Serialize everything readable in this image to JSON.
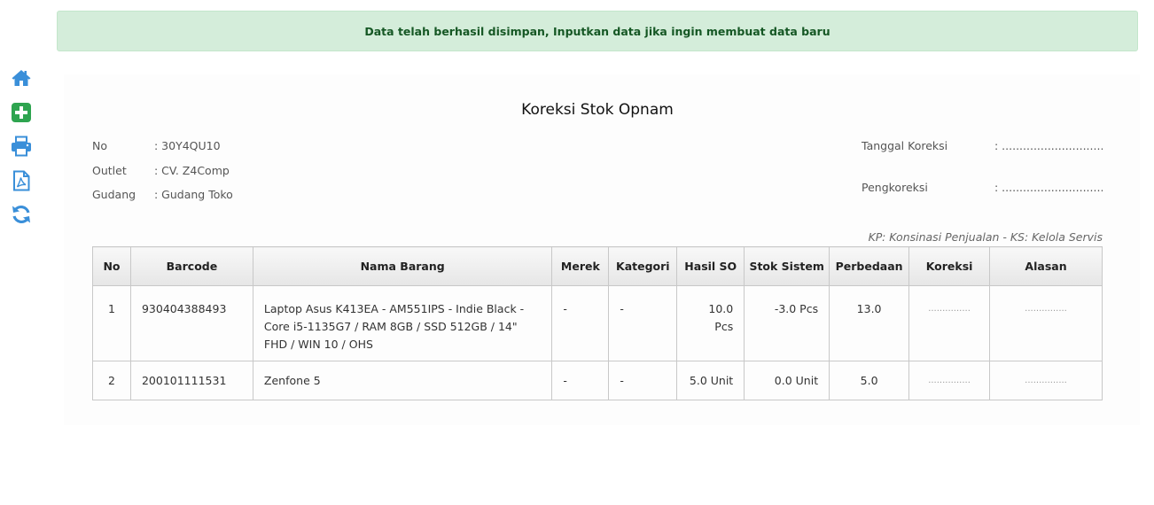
{
  "alert": {
    "message": "Data telah berhasil disimpan, Inputkan data jika ingin membuat data baru"
  },
  "colors": {
    "icon_blue": "#3a8fd9",
    "icon_green": "#2ea44f",
    "alert_bg": "#d4edda",
    "alert_text": "#155724"
  },
  "sidebar": {
    "icons": [
      "home-icon",
      "add-icon",
      "print-icon",
      "pdf-icon",
      "refresh-icon"
    ]
  },
  "document": {
    "title": "Koreksi Stok Opnam",
    "meta_left": [
      {
        "label": "No",
        "value": ": 30Y4QU10"
      },
      {
        "label": "Outlet",
        "value": ": CV. Z4Comp"
      },
      {
        "label": "Gudang",
        "value": ": Gudang Toko"
      }
    ],
    "meta_right": [
      {
        "label": "Tanggal Koreksi",
        "value": ": ........................................"
      },
      {
        "label": "Pengkoreksi",
        "value": ": ........................................"
      }
    ],
    "legend_note": "KP: Konsinasi Penjualan - KS: Kelola Servis"
  },
  "table": {
    "headers": [
      "No",
      "Barcode",
      "Nama Barang",
      "Merek",
      "Kategori",
      "Hasil SO",
      "Stok Sistem",
      "Perbedaan",
      "Koreksi",
      "Alasan"
    ],
    "rows": [
      {
        "no": "1",
        "barcode": "930404388493",
        "nama": "Laptop Asus K413EA - AM551IPS - Indie Black - Core i5-1135G7 / RAM 8GB / SSD 512GB / 14\" FHD / WIN 10 / OHS",
        "merek": "-",
        "kategori": "-",
        "hasil_so": "10.0 Pcs",
        "stok_sistem": "-3.0 Pcs",
        "perbedaan": "13.0",
        "koreksi": "...............",
        "alasan": "..............."
      },
      {
        "no": "2",
        "barcode": "200101111531",
        "nama": "Zenfone 5",
        "merek": "-",
        "kategori": "-",
        "hasil_so": "5.0 Unit",
        "stok_sistem": "0.0 Unit",
        "perbedaan": "5.0",
        "koreksi": "...............",
        "alasan": "..............."
      }
    ]
  }
}
